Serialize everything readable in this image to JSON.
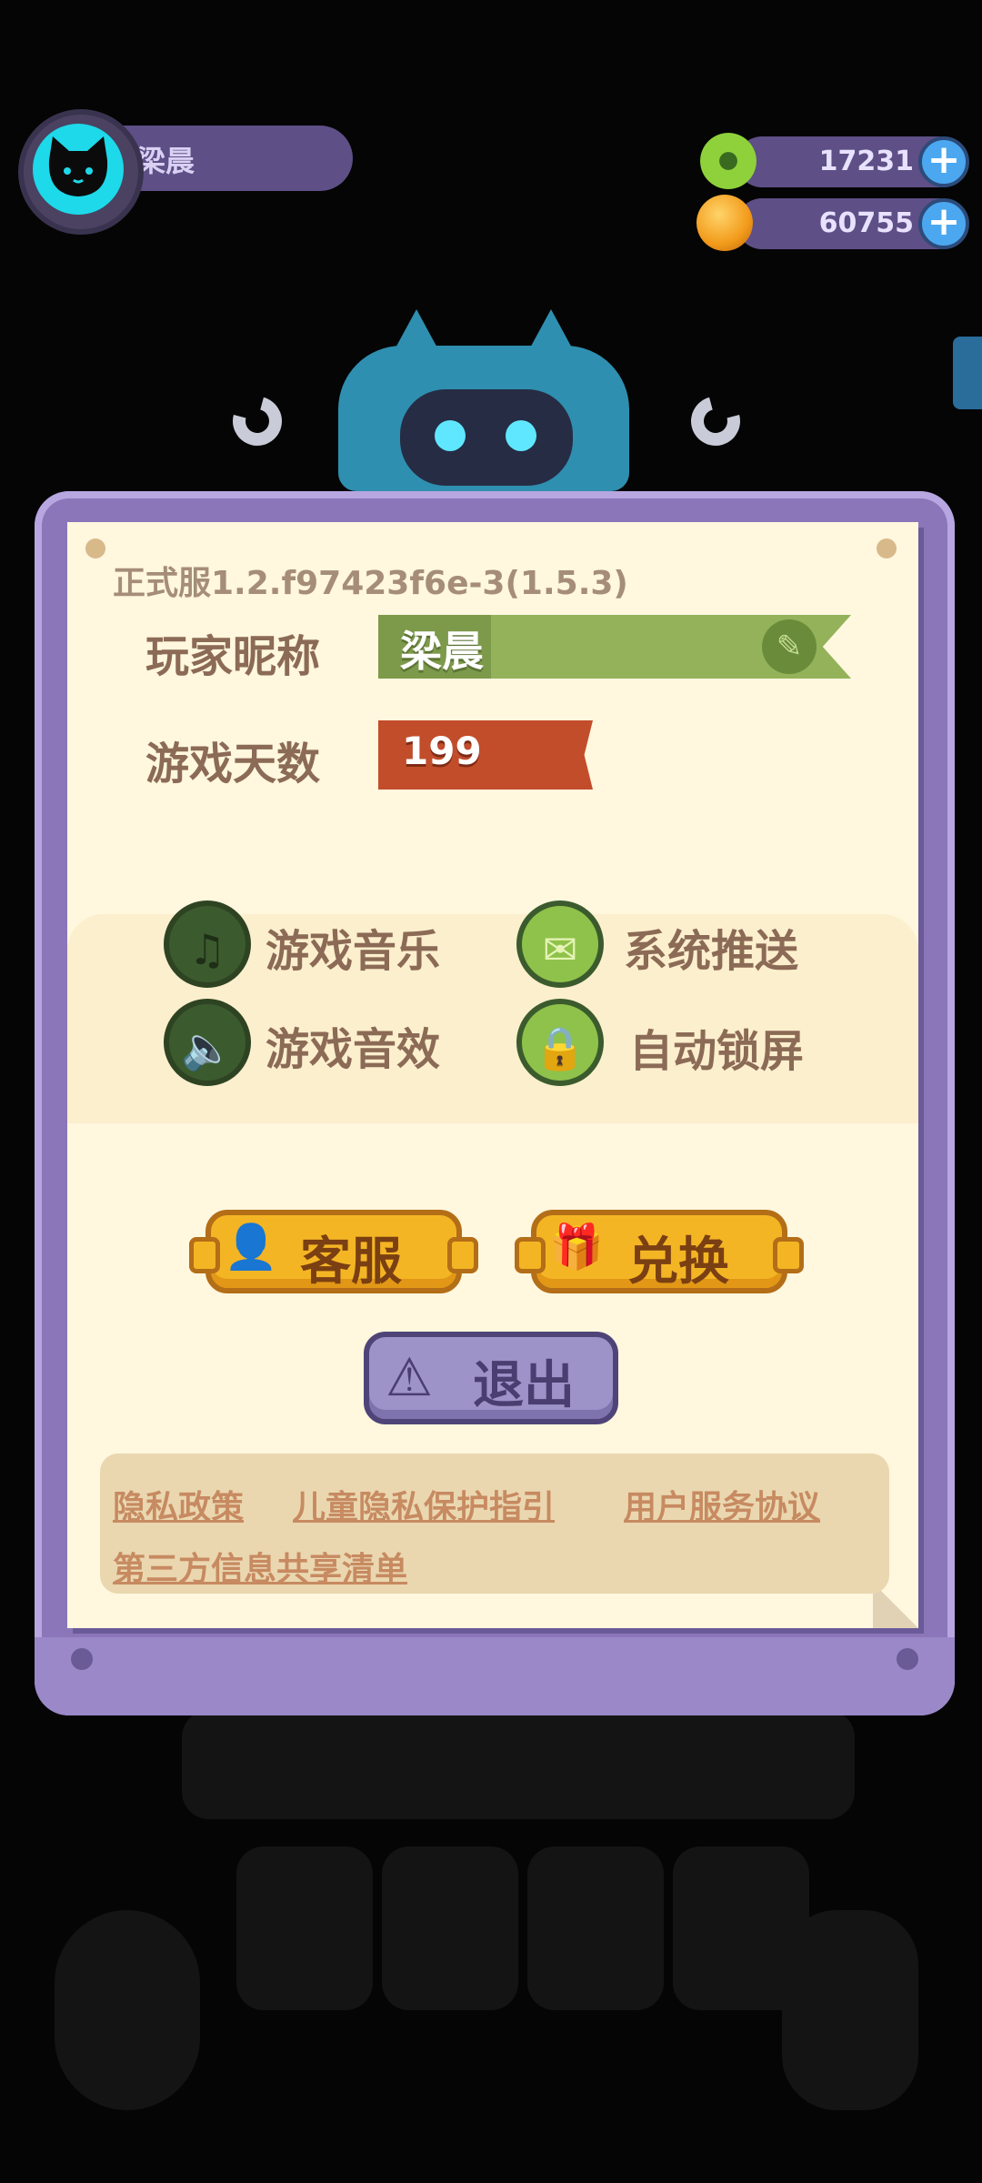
{
  "profile": {
    "name": "梁晨"
  },
  "currencies": [
    {
      "icon": "green-donut-coin-icon",
      "value": "17231"
    },
    {
      "icon": "orange-planet-coin-icon",
      "value": "60755"
    }
  ],
  "panel": {
    "version": "正式服1.2.f97423f6e-3(1.5.3)",
    "nickname_label": "玩家昵称",
    "nickname_value": "梁晨",
    "days_label": "游戏天数",
    "days_value": "199"
  },
  "settings": {
    "music": {
      "label": "游戏音乐",
      "icon": "music-note-icon",
      "state": "off"
    },
    "push": {
      "label": "系统推送",
      "icon": "envelope-icon",
      "state": "on"
    },
    "sfx": {
      "label": "游戏音效",
      "icon": "speaker-icon",
      "state": "off"
    },
    "autolock": {
      "label": "自动锁屏",
      "icon": "lock-icon",
      "state": "on"
    }
  },
  "buttons": {
    "service": "客服",
    "redeem": "兑换",
    "logout": "退出"
  },
  "links": {
    "privacy": "隐私政策",
    "child_privacy": "儿童隐私保护指引",
    "terms": "用户服务协议",
    "third_party": "第三方信息共享清单"
  },
  "colors": {
    "panel_purple": "#8a76b9",
    "paper": "#fff7de",
    "nickname_green": "#93b25a",
    "days_red": "#c24d2b",
    "gold_button": "#f4b524"
  }
}
